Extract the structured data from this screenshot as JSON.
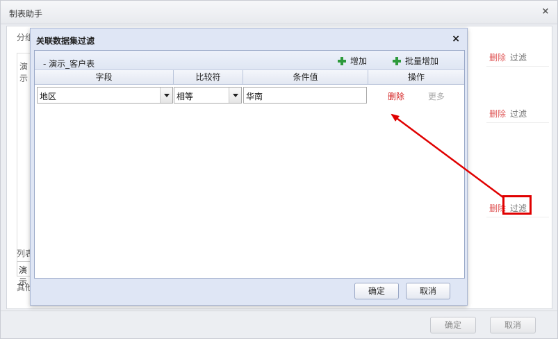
{
  "outer_dialog": {
    "title": "制表助手",
    "close_symbol": "×",
    "labels": {
      "group": "分组",
      "left_panel": "演示",
      "list": "列表",
      "input_text": "演示",
      "other": "其他"
    },
    "rows": [
      {
        "delete_label": "删除",
        "filter_label": "过滤"
      },
      {
        "delete_label": "删除",
        "filter_label": "过滤"
      },
      {
        "delete_label": "删除",
        "filter_label": "过滤"
      }
    ],
    "confirm_label": "确定",
    "cancel_label": "取消"
  },
  "modal": {
    "title": "关联数据集过滤",
    "close_symbol": "×",
    "group_title": "-  演示_客户表",
    "add_label": "增加",
    "batch_add_label": "批量增加",
    "columns": [
      "字段",
      "比较符",
      "条件值",
      "操作"
    ],
    "rows": [
      {
        "field": "地区",
        "operator": "相等",
        "value": "华南",
        "delete_label": "删除",
        "more_label": "更多"
      }
    ],
    "confirm_label": "确定",
    "cancel_label": "取消"
  },
  "colors": {
    "annotation": "#e00000",
    "delete_red": "#d42222",
    "add_green": "#2e9a3c"
  }
}
